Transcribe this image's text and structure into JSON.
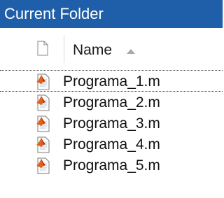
{
  "panel": {
    "title": "Current Folder"
  },
  "header": {
    "name_label": "Name",
    "sort_direction": "ascending",
    "sort_icon": "sort-ascending-icon",
    "file_column_icon": "blank-file-icon"
  },
  "files": [
    {
      "name": "Programa_1.m",
      "icon": "matlab-script-file-icon"
    },
    {
      "name": "Programa_2.m",
      "icon": "matlab-script-file-icon"
    },
    {
      "name": "Programa_3.m",
      "icon": "matlab-script-file-icon"
    },
    {
      "name": "Programa_4.m",
      "icon": "matlab-script-file-icon"
    },
    {
      "name": "Programa_5.m",
      "icon": "matlab-script-file-icon"
    }
  ],
  "colors": {
    "title_bar": "#1f5fa9",
    "title_text": "#ffffff"
  }
}
